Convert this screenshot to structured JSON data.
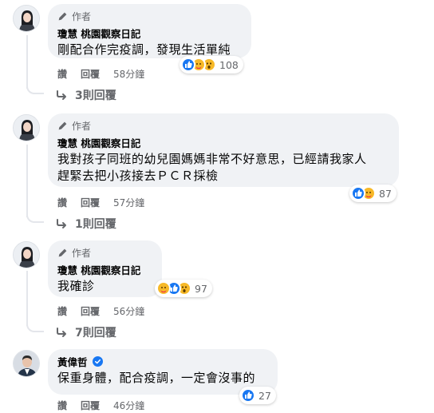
{
  "colors": {
    "like": "#1877f2",
    "care_yellow": "#f7b928",
    "heart": "#f02849",
    "bubble": "#f0f2f5",
    "meta": "#65676b"
  },
  "comments": [
    {
      "author_badge": "作者",
      "name": "瓊慧 桃園觀察日記",
      "text_lines": [
        "剛配合作完疫調，發現生活單純"
      ],
      "reactions": [
        "like",
        "care",
        "wow"
      ],
      "reaction_count": "108",
      "actions": {
        "like": "讚",
        "reply": "回覆",
        "time": "58分鐘"
      },
      "replies_label": "3則回覆"
    },
    {
      "author_badge": "作者",
      "name": "瓊慧 桃園觀察日記",
      "text_lines": [
        "我對孩子同班的幼兒園媽媽非常不好意思，已經請我家人",
        "趕緊去把小孩接去ＰＣＲ採檢"
      ],
      "reactions": [
        "like",
        "care"
      ],
      "reaction_count": "87",
      "actions": {
        "like": "讚",
        "reply": "回覆",
        "time": "57分鐘"
      },
      "replies_label": "1則回覆"
    },
    {
      "author_badge": "作者",
      "name": "瓊慧 桃園觀察日記",
      "text_lines": [
        "我確診"
      ],
      "reactions": [
        "care",
        "like",
        "wow"
      ],
      "reaction_count": "97",
      "actions": {
        "like": "讚",
        "reply": "回覆",
        "time": "56分鐘"
      },
      "replies_label": "7則回覆"
    },
    {
      "name": "黃偉哲",
      "verified": true,
      "text_lines": [
        "保重身體，配合疫調，一定會沒事的"
      ],
      "reactions": [
        "like"
      ],
      "reaction_count": "27",
      "actions": {
        "like": "讚",
        "reply": "回覆",
        "time": "46分鐘"
      }
    }
  ]
}
